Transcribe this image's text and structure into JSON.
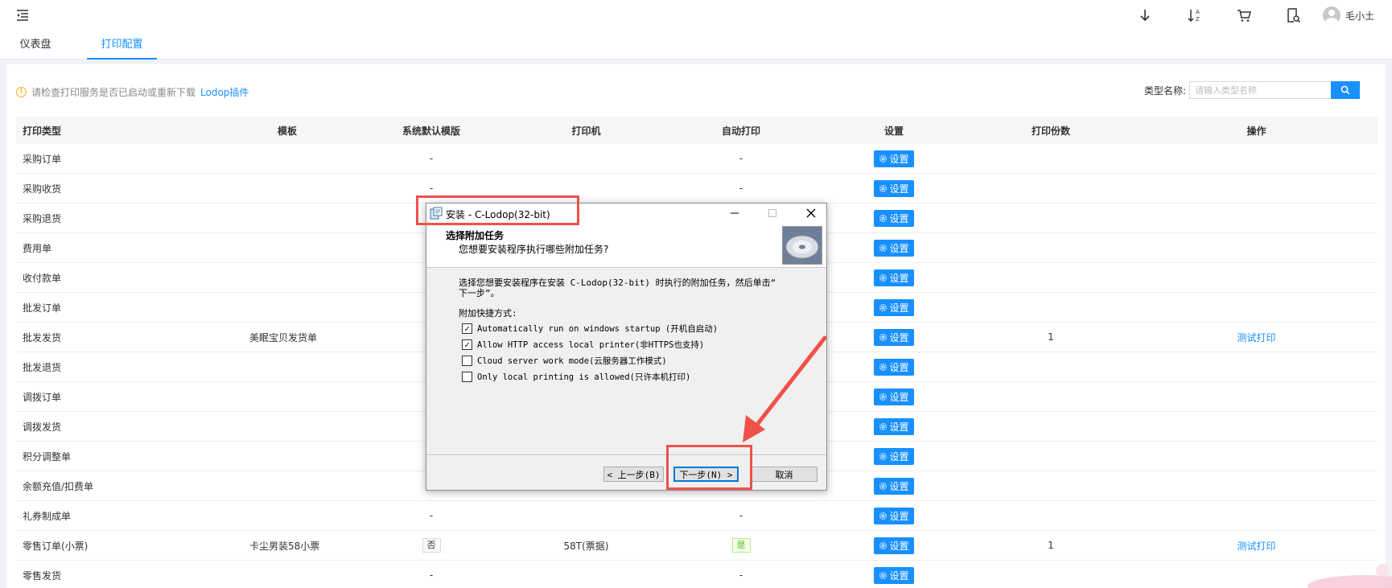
{
  "header": {
    "user_name": "毛小土",
    "icons": [
      "menu-fold-icon",
      "download-icon",
      "sort-icon",
      "cart-icon",
      "search-doc-icon",
      "avatar-icon"
    ]
  },
  "tabs": [
    {
      "label": "仪表盘",
      "active": false
    },
    {
      "label": "打印配置",
      "active": true
    }
  ],
  "notice": {
    "text": "请检查打印服务是否已启动或重新下载",
    "link": "Lodop插件"
  },
  "search": {
    "label": "类型名称:",
    "placeholder": "请输入类型名称"
  },
  "table": {
    "columns": [
      "打印类型",
      "模板",
      "系统默认模版",
      "打印机",
      "自动打印",
      "设置",
      "打印份数",
      "操作"
    ],
    "set_label": "设置",
    "rows": [
      {
        "type": "采购订单",
        "template": "",
        "default": "-",
        "printer": "",
        "auto": "-",
        "copies": "",
        "action": ""
      },
      {
        "type": "采购收货",
        "template": "",
        "default": "-",
        "printer": "",
        "auto": "-",
        "copies": "",
        "action": ""
      },
      {
        "type": "采购退货",
        "template": "",
        "default": "",
        "printer": "",
        "auto": "",
        "copies": "",
        "action": ""
      },
      {
        "type": "费用单",
        "template": "",
        "default": "",
        "printer": "",
        "auto": "",
        "copies": "",
        "action": ""
      },
      {
        "type": "收付款单",
        "template": "",
        "default": "",
        "printer": "",
        "auto": "",
        "copies": "",
        "action": ""
      },
      {
        "type": "批发订单",
        "template": "",
        "default": "",
        "printer": "",
        "auto": "",
        "copies": "",
        "action": ""
      },
      {
        "type": "批发发货",
        "template": "美眠宝贝发货单",
        "default": "",
        "printer": "",
        "auto": "",
        "copies": "1",
        "action": "测试打印"
      },
      {
        "type": "批发退货",
        "template": "",
        "default": "",
        "printer": "",
        "auto": "",
        "copies": "",
        "action": ""
      },
      {
        "type": "调拨订单",
        "template": "",
        "default": "",
        "printer": "",
        "auto": "",
        "copies": "",
        "action": ""
      },
      {
        "type": "调拨发货",
        "template": "",
        "default": "",
        "printer": "",
        "auto": "",
        "copies": "",
        "action": ""
      },
      {
        "type": "积分调整单",
        "template": "",
        "default": "",
        "printer": "",
        "auto": "",
        "copies": "",
        "action": ""
      },
      {
        "type": "余额充值/扣费单",
        "template": "",
        "default": "",
        "printer": "",
        "auto": "",
        "copies": "",
        "action": ""
      },
      {
        "type": "礼券制成单",
        "template": "",
        "default": "-",
        "printer": "",
        "auto": "-",
        "copies": "",
        "action": ""
      },
      {
        "type": "零售订单(小票)",
        "template": "卡尘男装58小票",
        "default_tag": "否",
        "printer": "58T(票据)",
        "auto_tag": "是",
        "copies": "1",
        "action": "测试打印"
      },
      {
        "type": "零售发货",
        "template": "",
        "default": "-",
        "printer": "",
        "auto": "-",
        "copies": "",
        "action": ""
      }
    ]
  },
  "dialog": {
    "title": "安装 - C-Lodop(32-bit)",
    "header_title": "选择附加任务",
    "header_subtitle": "您想要安装程序执行哪些附加任务?",
    "body_line1": "选择您想要安装程序在安装 C-Lodop(32-bit) 时执行的附加任务，然后单击“",
    "body_line2": "下一步”。",
    "group_label": "附加快捷方式:",
    "options": [
      {
        "label": "Automatically run on windows startup (开机自启动)",
        "checked": true
      },
      {
        "label": "Allow HTTP access local printer(非HTTPS也支持)",
        "checked": true
      },
      {
        "label": "Cloud server work mode(云服务器工作模式)",
        "checked": false
      },
      {
        "label": "Only local printing is allowed(只许本机打印)",
        "checked": false
      }
    ],
    "back_button": "< 上一步(B)",
    "next_button": "下一步(N) >",
    "cancel_button": "取消"
  },
  "colors": {
    "primary": "#1890ff",
    "annotation_red": "#f0514a",
    "warning": "#faad14"
  }
}
